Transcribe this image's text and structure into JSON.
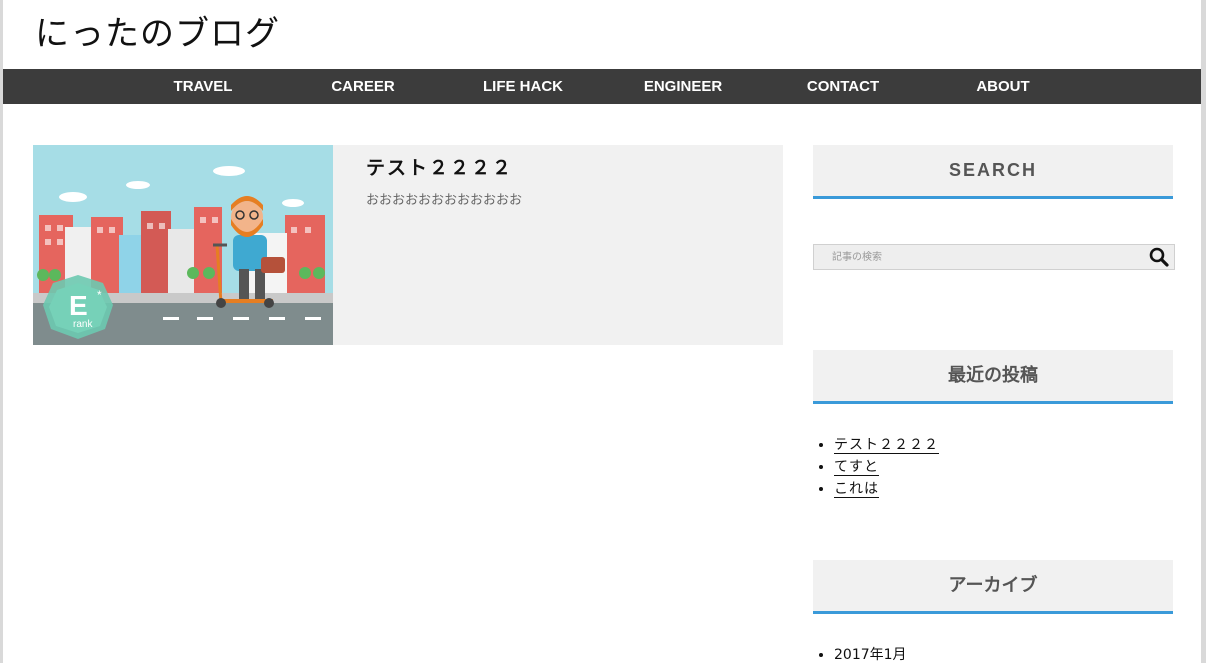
{
  "site": {
    "title": "にったのブログ"
  },
  "nav": {
    "items": [
      "TRAVEL",
      "CAREER",
      "LIFE HACK",
      "ENGINEER",
      "CONTACT",
      "ABOUT"
    ]
  },
  "post": {
    "title": "テスト２２２２",
    "excerpt": "おおおおおおおおおおおお",
    "thumbnail_badge": "E",
    "thumbnail_badge_sub": "rank"
  },
  "sidebar": {
    "search": {
      "heading": "SEARCH",
      "placeholder": "記事の検索",
      "icon": "magnifier-icon"
    },
    "recent": {
      "heading": "最近の投稿",
      "items": [
        "テスト２２２２",
        "てすと",
        "これは"
      ]
    },
    "archive": {
      "heading": "アーカイブ",
      "items": [
        "2017年1月"
      ]
    }
  },
  "colors": {
    "nav_bg": "#3c3c3c",
    "accent": "#3a9ad9",
    "card_bg": "#f1f1f1"
  }
}
